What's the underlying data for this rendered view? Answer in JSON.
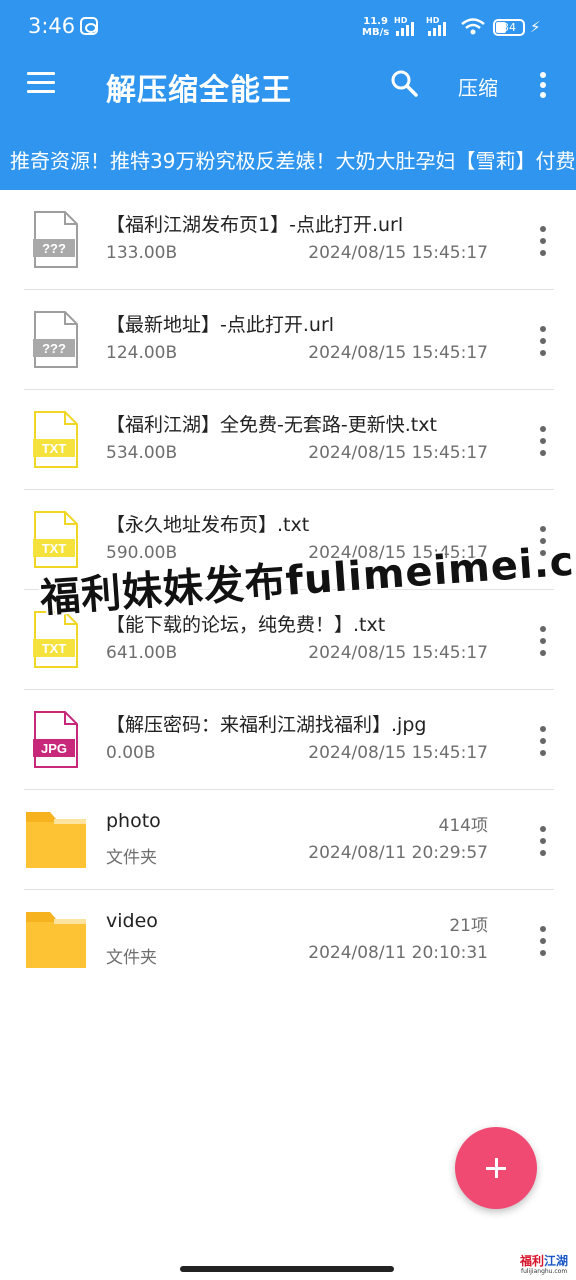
{
  "status_bar": {
    "time": "3:46",
    "net_speed_value": "11.9",
    "net_speed_unit": "MB/s",
    "battery": "34"
  },
  "app_bar": {
    "title": "解压缩全能王",
    "compress_label": "压缩"
  },
  "ticker_text": "推奇资源！推特39万粉究极反差婊！大奶大肚孕妇【雪莉】付费",
  "colors": {
    "primary": "#2f95ee",
    "fab": "#f04a73",
    "folder": "#fec334",
    "txt_icon": "#f5e23c",
    "jpg_icon": "#c7287a",
    "unknown_icon": "#9e9e9e"
  },
  "files": [
    {
      "name": "【福利江湖发布页1】-点此打开.url",
      "size": "133.00B",
      "date": "2024/08/15 15:45:17",
      "icon": "unknown-file-icon",
      "badge": "???"
    },
    {
      "name": "【最新地址】-点此打开.url",
      "size": "124.00B",
      "date": "2024/08/15 15:45:17",
      "icon": "unknown-file-icon",
      "badge": "???"
    },
    {
      "name": "【福利江湖】全免费-无套路-更新快.txt",
      "size": "534.00B",
      "date": "2024/08/15 15:45:17",
      "icon": "txt-file-icon",
      "badge": "TXT"
    },
    {
      "name": "【永久地址发布页】.txt",
      "size": "590.00B",
      "date": "2024/08/15 15:45:17",
      "icon": "txt-file-icon",
      "badge": "TXT"
    },
    {
      "name": "【能下载的论坛，纯免费！】.txt",
      "size": "641.00B",
      "date": "2024/08/15 15:45:17",
      "icon": "txt-file-icon",
      "badge": "TXT"
    },
    {
      "name": "【解压密码：来福利江湖找福利】.jpg",
      "size": "0.00B",
      "date": "2024/08/15 15:45:17",
      "icon": "jpg-file-icon",
      "badge": "JPG"
    }
  ],
  "folders": [
    {
      "name": "photo",
      "type": "文件夹",
      "count": "414项",
      "date": "2024/08/11 20:29:57"
    },
    {
      "name": "video",
      "type": "文件夹",
      "count": "21项",
      "date": "2024/08/11 20:10:31"
    }
  ],
  "watermark": "福利妹妹发布fulimeimei.com",
  "corner_logo": {
    "text_red": "福利",
    "text_blue": "江湖",
    "subtext": "fulijianghu.com"
  }
}
